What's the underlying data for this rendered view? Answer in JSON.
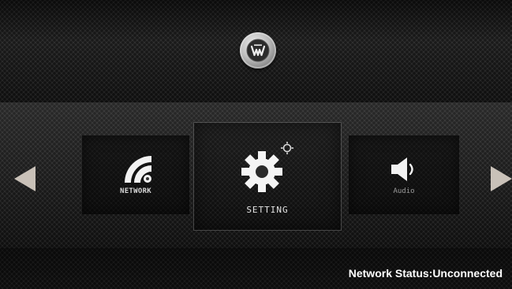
{
  "brand": {
    "logo_icon": "westinghouse-w-logo-icon",
    "accent": "#c9c1b8"
  },
  "menu": {
    "items": [
      {
        "id": "network",
        "label": "NETWORK",
        "icon": "wifi-signal-icon"
      },
      {
        "id": "setting",
        "label": "SETTING",
        "icon": "gear-icon",
        "selected": true
      },
      {
        "id": "audio",
        "label": "Audio",
        "icon": "speaker-icon"
      }
    ],
    "prev_icon": "left-arrow-icon",
    "next_icon": "right-arrow-icon"
  },
  "status": {
    "text": "Network Status:Unconnected"
  }
}
